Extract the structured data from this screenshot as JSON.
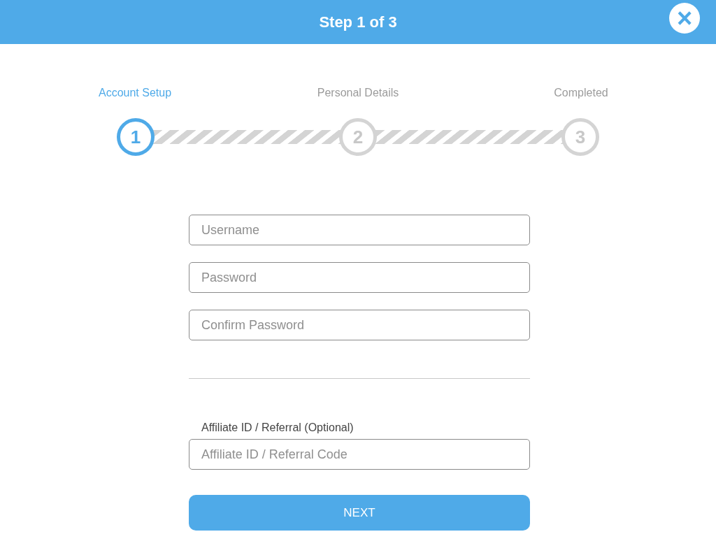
{
  "header": {
    "title": "Step 1 of 3",
    "close": "×"
  },
  "steps": [
    {
      "label": "Account Setup",
      "number": "1",
      "selected": true
    },
    {
      "label": "Personal Details",
      "number": "2",
      "selected": false
    },
    {
      "label": "Completed",
      "number": "3",
      "selected": false
    }
  ],
  "fields": [
    {
      "placeholder": "Username"
    },
    {
      "placeholder": "Password"
    },
    {
      "placeholder": "Confirm Password"
    }
  ],
  "affiliate": {
    "label": "Affiliate ID / Referral (Optional)",
    "placeholder": "Affiliate ID / Referral Code"
  },
  "next_button": "NEXT"
}
